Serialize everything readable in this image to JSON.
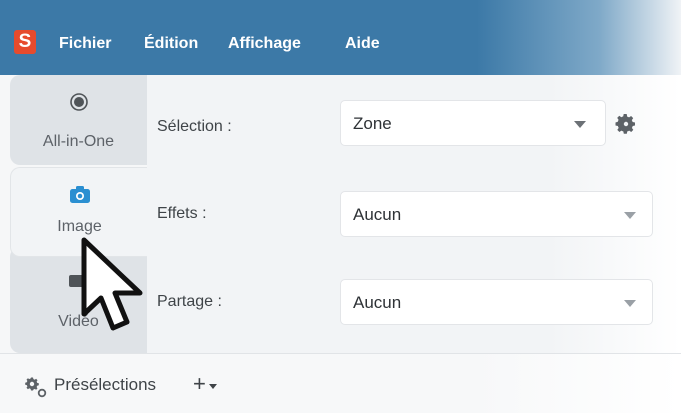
{
  "app": {
    "logo_letter": "S",
    "brand_color": "#e64b2d",
    "menubar_color": "#3c79a7"
  },
  "menu": {
    "items": [
      {
        "label": "Fichier"
      },
      {
        "label": "Édition"
      },
      {
        "label": "Affichage"
      },
      {
        "label": "Aide"
      }
    ]
  },
  "tabs": [
    {
      "label": "All-in-One",
      "icon": "radio-record-icon",
      "active": false
    },
    {
      "label": "Image",
      "icon": "camera-icon",
      "active": true
    },
    {
      "label": "Vidéo",
      "icon": "video-camera-icon",
      "active": false
    }
  ],
  "settings": [
    {
      "label": "Sélection :",
      "value": "Zone",
      "has_gear": true
    },
    {
      "label": "Effets :",
      "value": "Aucun",
      "has_gear": false
    },
    {
      "label": "Partage :",
      "value": "Aucun",
      "has_gear": false
    }
  ],
  "footer": {
    "presets_label": "Présélections",
    "add_label": "+"
  },
  "pointer": {
    "icon": "mouse-pointer-icon"
  }
}
